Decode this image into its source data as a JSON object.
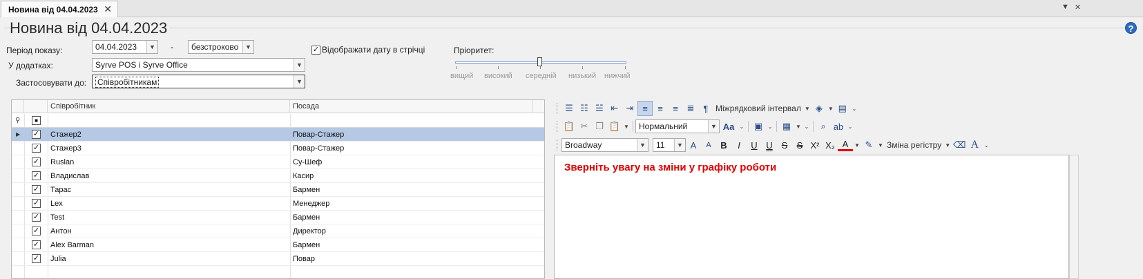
{
  "tab": {
    "label": "Новина від 04.04.2023",
    "close": "✕"
  },
  "window_controls": {
    "dropdown": "▼",
    "close": "✕"
  },
  "title": "Новина від 04.04.2023",
  "help": "?",
  "form": {
    "period_label": "Період показу:",
    "date_from": "04.04.2023",
    "dash": "-",
    "date_to": "безстроково",
    "show_date_label": "Відображати дату в стрічці",
    "show_date_checked": true,
    "apps_label": "У додатках:",
    "apps_value": "Syrve POS і Syrve Office",
    "apply_to_label": "Застосовувати до:",
    "apply_to_value": "Співробітникам",
    "priority_label": "Пріоритет:",
    "priority_levels": [
      "вищий",
      "високий",
      "середній",
      "низький",
      "нижчий"
    ],
    "priority_selected": "середній"
  },
  "grid": {
    "columns": [
      "Співробітник",
      "Посада"
    ],
    "rows": [
      {
        "name": "Стажер2",
        "position": "Повар-Стажер",
        "checked": true,
        "selected": true
      },
      {
        "name": "Стажер3",
        "position": "Повар-Стажер",
        "checked": true
      },
      {
        "name": "Ruslan",
        "position": "Су-Шеф",
        "checked": true
      },
      {
        "name": "Владислав",
        "position": "Касир",
        "checked": true
      },
      {
        "name": "Тарас",
        "position": "Бармен",
        "checked": true
      },
      {
        "name": "Lex",
        "position": "Менеджер",
        "checked": true
      },
      {
        "name": "Test",
        "position": "Бармен",
        "checked": true
      },
      {
        "name": "Антон",
        "position": "Директор",
        "checked": true
      },
      {
        "name": "Alex Barman",
        "position": "Бармен",
        "checked": true
      },
      {
        "name": "Julia",
        "position": "Повар",
        "checked": true
      }
    ]
  },
  "editor": {
    "line_spacing": "Міжрядковий інтервал",
    "style": "Нормальний",
    "font": "Broadway",
    "font_size": "11",
    "change_case": "Зміна регістру",
    "content": "Зверніть увагу на зміни у графіку роботи",
    "content_color": "#e00000"
  }
}
